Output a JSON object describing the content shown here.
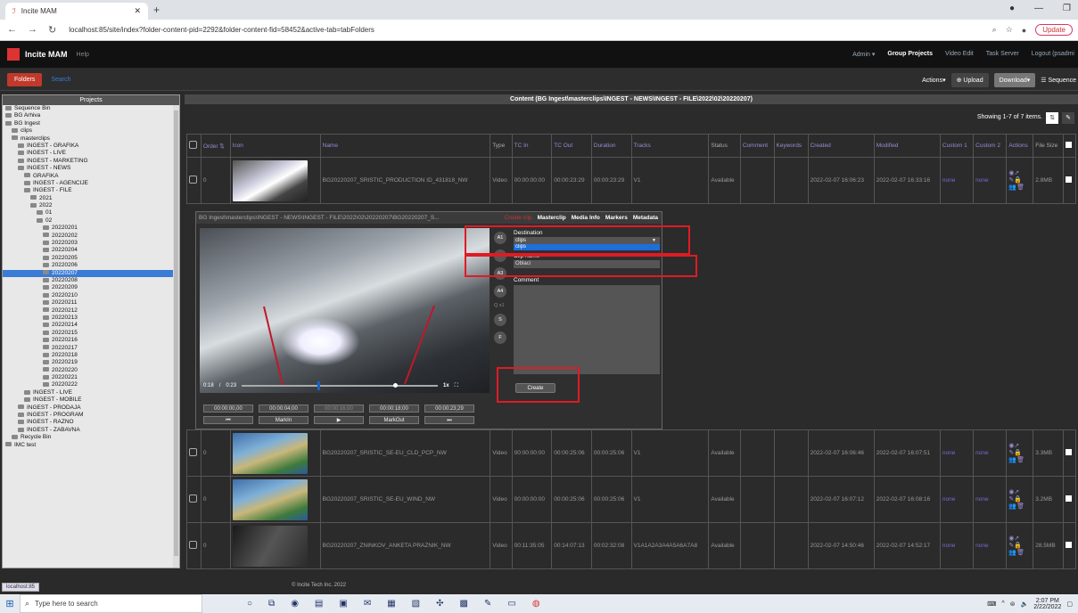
{
  "browser": {
    "tab_title": "Incite MAM",
    "url": "localhost:85/site/index?folder-content-pid=2292&folder-content-fid=58452&active-tab=tabFolders",
    "update_label": "Update",
    "status_url": "localhost:85"
  },
  "app": {
    "name": "Incite MAM",
    "help": "Help",
    "nav": [
      "Admin ▾",
      "Group Projects",
      "Video Edit",
      "Task Server",
      "Logout (psadmi"
    ],
    "folders_button": "Folders",
    "search_link": "Search",
    "actions": "Actions▾",
    "upload": "⊕ Upload",
    "download": "Download▾",
    "sequence": "☰ Sequence",
    "footer": "© Incite Tech Inc. 2022"
  },
  "projects": {
    "header": "Projects",
    "tree": [
      {
        "label": "Sequence Bin",
        "indent": 0
      },
      {
        "label": "BG Arhiva",
        "indent": 0
      },
      {
        "label": "BG Ingest",
        "indent": 0
      },
      {
        "label": "clips",
        "indent": 1
      },
      {
        "label": "masterclips",
        "indent": 1
      },
      {
        "label": "INGEST - GRAFIKA",
        "indent": 2
      },
      {
        "label": "INGEST - LIVE",
        "indent": 2
      },
      {
        "label": "INGEST - MARKETING",
        "indent": 2
      },
      {
        "label": "INGEST - NEWS",
        "indent": 2
      },
      {
        "label": "GRAFIKA",
        "indent": 3
      },
      {
        "label": "INGEST - AGENCIJE",
        "indent": 3
      },
      {
        "label": "INGEST - FILE",
        "indent": 3
      },
      {
        "label": "2021",
        "indent": 4
      },
      {
        "label": "2022",
        "indent": 4
      },
      {
        "label": "01",
        "indent": 5
      },
      {
        "label": "02",
        "indent": 5
      },
      {
        "label": "20220201",
        "indent": 6
      },
      {
        "label": "20220202",
        "indent": 6
      },
      {
        "label": "20220203",
        "indent": 6
      },
      {
        "label": "20220204",
        "indent": 6
      },
      {
        "label": "20220205",
        "indent": 6
      },
      {
        "label": "20220206",
        "indent": 6
      },
      {
        "label": "20220207",
        "indent": 6,
        "selected": true
      },
      {
        "label": "20220208",
        "indent": 6
      },
      {
        "label": "20220209",
        "indent": 6
      },
      {
        "label": "20220210",
        "indent": 6
      },
      {
        "label": "20220211",
        "indent": 6
      },
      {
        "label": "20220212",
        "indent": 6
      },
      {
        "label": "20220213",
        "indent": 6
      },
      {
        "label": "20220214",
        "indent": 6
      },
      {
        "label": "20220215",
        "indent": 6
      },
      {
        "label": "20220216",
        "indent": 6
      },
      {
        "label": "20220217",
        "indent": 6
      },
      {
        "label": "20220218",
        "indent": 6
      },
      {
        "label": "20220219",
        "indent": 6
      },
      {
        "label": "20220220",
        "indent": 6
      },
      {
        "label": "20220221",
        "indent": 6
      },
      {
        "label": "20220222",
        "indent": 6
      },
      {
        "label": "INGEST - LIVE",
        "indent": 3
      },
      {
        "label": "INGEST - MOBILE",
        "indent": 3
      },
      {
        "label": "INGEST - PRODAJA",
        "indent": 2
      },
      {
        "label": "INGEST - PROGRAM",
        "indent": 2
      },
      {
        "label": "INGEST - RAZNO",
        "indent": 2
      },
      {
        "label": "INGEST - ZABAVNA",
        "indent": 2
      },
      {
        "label": "Recycle Bin",
        "indent": 1
      },
      {
        "label": "IMC test",
        "indent": 0
      }
    ]
  },
  "content": {
    "header": "Content (BG Ingest\\masterclips\\INGEST - NEWS\\INGEST - FILE\\2022\\02\\20220207)",
    "showing": "Showing 1-7 of 7 items.",
    "columns": [
      "",
      "Order ⇅",
      "Icon",
      "Name",
      "Type",
      "TC In",
      "TC Out",
      "Duration",
      "Tracks",
      "Status",
      "Comment",
      "Keywords",
      "Created",
      "Modified",
      "Custom 1",
      "Custom 2",
      "Actions",
      "File Size",
      ""
    ],
    "rows": [
      {
        "order": "0",
        "name": "BG20220207_SRISTIC_PRODUCTION ID_431818_NW",
        "type": "Video",
        "tc_in": "00:00:00:00",
        "tc_out": "00:00:23:29",
        "duration": "00:00:23:29",
        "tracks": "V1",
        "status": "Available",
        "created": "2022-02-07 16:06:23",
        "modified": "2022-02-07 16:33:16",
        "custom1": "none",
        "custom2": "none",
        "size": "2.8MB",
        "thumb": "sky"
      },
      {
        "order": "0",
        "name": "BG20220207_SRISTIC_SE-EU_CLD_PCP_NW",
        "type": "Video",
        "tc_in": "00:00:00:00",
        "tc_out": "00:00:25:06",
        "duration": "00:00:25:06",
        "tracks": "V1",
        "status": "Available",
        "created": "2022-02-07 16:06:46",
        "modified": "2022-02-07 16:07:51",
        "custom1": "none",
        "custom2": "none",
        "size": "3.3MB",
        "thumb": "map"
      },
      {
        "order": "0",
        "name": "BG20220207_SRISTIC_SE-EU_WIND_NW",
        "type": "Video",
        "tc_in": "00:00:00:00",
        "tc_out": "00:00:25:06",
        "duration": "00:00:25:06",
        "tracks": "V1",
        "status": "Available",
        "created": "2022-02-07 16:07:12",
        "modified": "2022-02-07 16:08:16",
        "custom1": "none",
        "custom2": "none",
        "size": "3.2MB",
        "thumb": "map"
      },
      {
        "order": "0",
        "name": "BG20220207_ZNINKOV_ANKETA PRAZNIK_NW",
        "type": "Video",
        "tc_in": "00:11:35:05",
        "tc_out": "00:14:07:13",
        "duration": "00:02:32:08",
        "tracks": "V1A1A2A3A4A5A6A7A8",
        "status": "Available",
        "created": "2022-02-07 14:50:46",
        "modified": "2022-02-07 14:52:17",
        "custom1": "none",
        "custom2": "none",
        "size": "28.5MB",
        "thumb": "dark"
      }
    ]
  },
  "editor": {
    "path": "BG Ingest\\masterclips\\INGEST - NEWS\\INGEST - FILE\\2022\\02\\20220207\\BG20220207_S...",
    "tabs": [
      "Create clip",
      "Masterclip",
      "Media Info",
      "Markers",
      "Metadata"
    ],
    "time_current": "0:18",
    "time_sep": "/",
    "time_total": "0:23",
    "speed": "1x",
    "timecodes": [
      "00:00:00,00",
      "00:00:04;00",
      "00:00:16;00",
      "00:00:18;00",
      "00:00:23;29"
    ],
    "buttons": [
      "⏮",
      "MarkIn",
      "▶",
      "MarkOut",
      "⏭"
    ],
    "side": [
      "A1",
      "A2",
      "A3",
      "A4",
      "Q x1",
      "S",
      "F"
    ],
    "destination_label": "Destination",
    "destination_value": "clips",
    "destination_option": "clips",
    "clipname_label": "Clip name",
    "clipname_value": "Oblaci",
    "comment_label": "Comment",
    "create_label": "Create"
  },
  "taskbar": {
    "search_placeholder": "Type here to search",
    "time": "2:07 PM",
    "date": "2/22/2022"
  },
  "colors": {
    "accent_red": "#c0392b",
    "link_purple": "#7a68d6",
    "selection_blue": "#3a7bd5",
    "annotation_red": "#e01b24"
  }
}
